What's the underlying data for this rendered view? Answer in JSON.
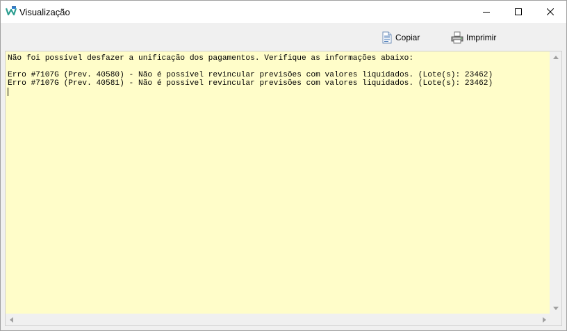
{
  "window": {
    "title": "Visualização",
    "controls": {
      "minimize_icon": "minimize-icon",
      "maximize_icon": "maximize-icon",
      "close_icon": "close-icon"
    }
  },
  "toolbar": {
    "copy_label": "Copiar",
    "copy_icon": "document-copy-icon",
    "print_label": "Imprimir",
    "print_icon": "printer-icon"
  },
  "content": {
    "background_color": "#fffdc9",
    "lines": [
      "Não foi possível desfazer a unificação dos pagamentos. Verifique as informações abaixo:",
      "",
      "Erro #7107G (Prev. 40580) - Não é possível revincular previsões com valores liquidados. (Lote(s): 23462)",
      "Erro #7107G (Prev. 40581) - Não é possível revincular previsões com valores liquidados. (Lote(s): 23462)"
    ]
  }
}
